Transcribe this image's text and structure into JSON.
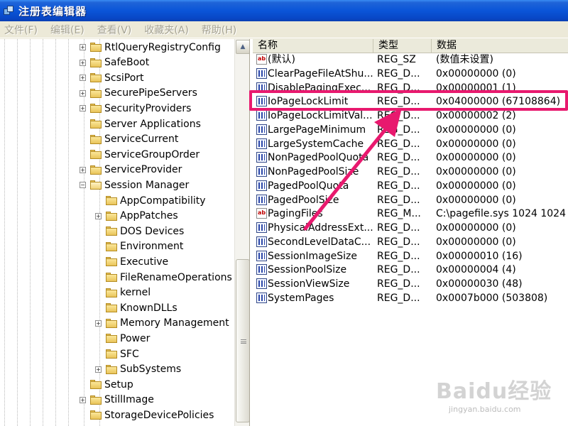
{
  "window": {
    "title": "注册表编辑器"
  },
  "menu": [
    "文件(F)",
    "编辑(E)",
    "查看(V)",
    "收藏夹(A)",
    "帮助(H)"
  ],
  "tree": {
    "items": [
      {
        "label": "RtlQueryRegistryConfig",
        "expander": "+",
        "level": 1
      },
      {
        "label": "SafeBoot",
        "expander": "+",
        "level": 1
      },
      {
        "label": "ScsiPort",
        "expander": "+",
        "level": 1
      },
      {
        "label": "SecurePipeServers",
        "expander": "+",
        "level": 1
      },
      {
        "label": "SecurityProviders",
        "expander": "+",
        "level": 1
      },
      {
        "label": "Server Applications",
        "expander": "",
        "level": 1
      },
      {
        "label": "ServiceCurrent",
        "expander": "",
        "level": 1
      },
      {
        "label": "ServiceGroupOrder",
        "expander": "",
        "level": 1
      },
      {
        "label": "ServiceProvider",
        "expander": "+",
        "level": 1
      },
      {
        "label": "Session Manager",
        "expander": "-",
        "level": 1
      },
      {
        "label": "AppCompatibility",
        "expander": "",
        "level": 2
      },
      {
        "label": "AppPatches",
        "expander": "+",
        "level": 2
      },
      {
        "label": "DOS Devices",
        "expander": "",
        "level": 2
      },
      {
        "label": "Environment",
        "expander": "",
        "level": 2
      },
      {
        "label": "Executive",
        "expander": "",
        "level": 2
      },
      {
        "label": "FileRenameOperations",
        "expander": "",
        "level": 2
      },
      {
        "label": "kernel",
        "expander": "",
        "level": 2
      },
      {
        "label": "KnownDLLs",
        "expander": "",
        "level": 2
      },
      {
        "label": "Memory Management",
        "expander": "+",
        "level": 2
      },
      {
        "label": "Power",
        "expander": "",
        "level": 2
      },
      {
        "label": "SFC",
        "expander": "",
        "level": 2
      },
      {
        "label": "SubSystems",
        "expander": "+",
        "level": 2
      },
      {
        "label": "Setup",
        "expander": "",
        "level": 1
      },
      {
        "label": "StillImage",
        "expander": "+",
        "level": 1
      },
      {
        "label": "StorageDevicePolicies",
        "expander": "",
        "level": 1
      }
    ]
  },
  "list": {
    "columns": [
      "名称",
      "类型",
      "数据"
    ],
    "rows": [
      {
        "icon": "string-icon",
        "name": "(默认)",
        "type": "REG_SZ",
        "data": "(数值未设置)"
      },
      {
        "icon": "binary-icon",
        "name": "ClearPageFileAtShu...",
        "type": "REG_D...",
        "data": "0x00000000 (0)"
      },
      {
        "icon": "binary-icon",
        "name": "DisablePagingExec...",
        "type": "REG_D...",
        "data": "0x00000001 (1)"
      },
      {
        "icon": "binary-icon",
        "name": "IoPageLockLimit",
        "type": "REG_D...",
        "data": "0x04000000 (67108864)"
      },
      {
        "icon": "binary-icon",
        "name": "IoPageLockLimitVal...",
        "type": "REG_D...",
        "data": "0x00000002 (2)"
      },
      {
        "icon": "binary-icon",
        "name": "LargePageMinimum",
        "type": "REG_D...",
        "data": "0x00000000 (0)"
      },
      {
        "icon": "binary-icon",
        "name": "LargeSystemCache",
        "type": "REG_D...",
        "data": "0x00000000 (0)"
      },
      {
        "icon": "binary-icon",
        "name": "NonPagedPoolQuota",
        "type": "REG_D...",
        "data": "0x00000000 (0)"
      },
      {
        "icon": "binary-icon",
        "name": "NonPagedPoolSize",
        "type": "REG_D...",
        "data": "0x00000000 (0)"
      },
      {
        "icon": "binary-icon",
        "name": "PagedPoolQuota",
        "type": "REG_D...",
        "data": "0x00000000 (0)"
      },
      {
        "icon": "binary-icon",
        "name": "PagedPoolSize",
        "type": "REG_D...",
        "data": "0x00000000 (0)"
      },
      {
        "icon": "string-icon",
        "name": "PagingFiles",
        "type": "REG_M...",
        "data": "C:\\pagefile.sys 1024 1024"
      },
      {
        "icon": "binary-icon",
        "name": "PhysicalAddressExt...",
        "type": "REG_D...",
        "data": "0x00000000 (0)"
      },
      {
        "icon": "binary-icon",
        "name": "SecondLevelDataC...",
        "type": "REG_D...",
        "data": "0x00000000 (0)"
      },
      {
        "icon": "binary-icon",
        "name": "SessionImageSize",
        "type": "REG_D...",
        "data": "0x00000010 (16)"
      },
      {
        "icon": "binary-icon",
        "name": "SessionPoolSize",
        "type": "REG_D...",
        "data": "0x00000004 (4)"
      },
      {
        "icon": "binary-icon",
        "name": "SessionViewSize",
        "type": "REG_D...",
        "data": "0x00000030 (48)"
      },
      {
        "icon": "binary-icon",
        "name": "SystemPages",
        "type": "REG_D...",
        "data": "0x0007b000 (503808)"
      }
    ]
  },
  "watermark": {
    "main": "Baidu经验",
    "sub": "jingyan.baidu.com"
  },
  "colors": {
    "highlight": "#e8196e",
    "titlebar": "#0a55d8"
  }
}
